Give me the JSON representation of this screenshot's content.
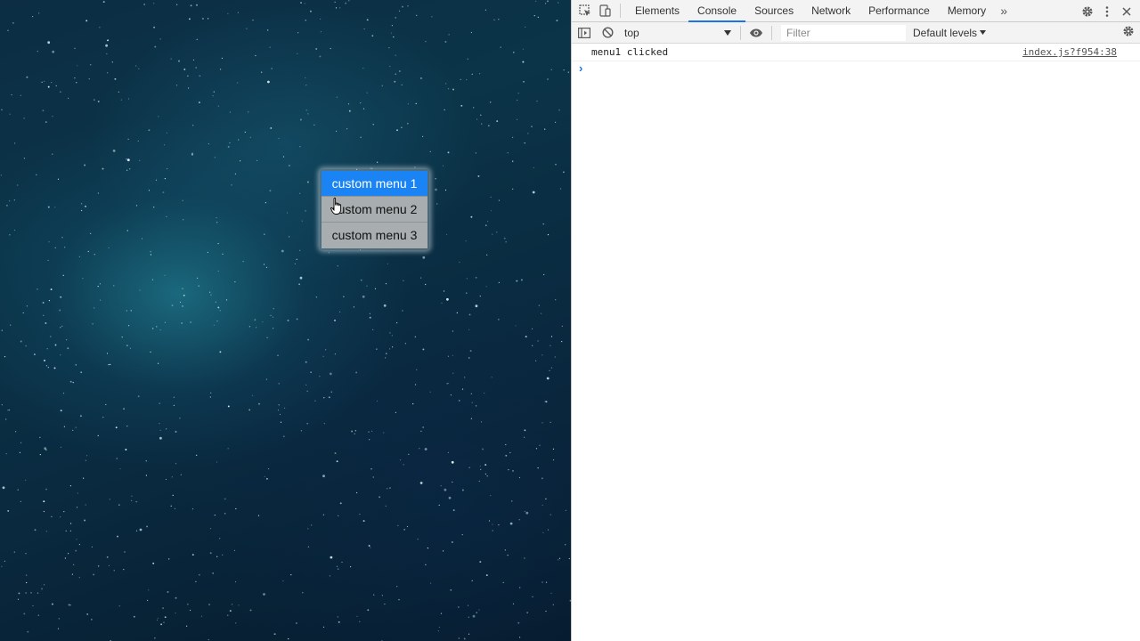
{
  "page": {
    "context_menu": {
      "items": [
        {
          "label": "custom menu 1",
          "active": true
        },
        {
          "label": "custom menu 2",
          "active": false
        },
        {
          "label": "custom menu 3",
          "active": false
        }
      ]
    }
  },
  "devtools": {
    "tabs": [
      "Elements",
      "Console",
      "Sources",
      "Network",
      "Performance",
      "Memory"
    ],
    "selected_tab": "Console",
    "more_tabs_glyph": "»",
    "toolbar": {
      "context": "top",
      "filter_placeholder": "Filter",
      "levels": "Default levels"
    },
    "console": {
      "messages": [
        {
          "text": "menu1 clicked",
          "source": "index.js?f954:38"
        }
      ],
      "prompt": "›"
    },
    "icons": [
      "inspect-icon",
      "device-toggle-icon",
      "settings-gear-icon",
      "kebab-menu-icon",
      "close-icon",
      "sidebar-toggle-icon",
      "clear-console-icon",
      "eye-icon",
      "dropdown-arrow-icon"
    ]
  },
  "colors": {
    "menu_active_bg": "#1a84f4",
    "menu_item_bg": "#a8adb0",
    "tab_underline": "#1a73e8",
    "space_bg": "#0b3448"
  }
}
